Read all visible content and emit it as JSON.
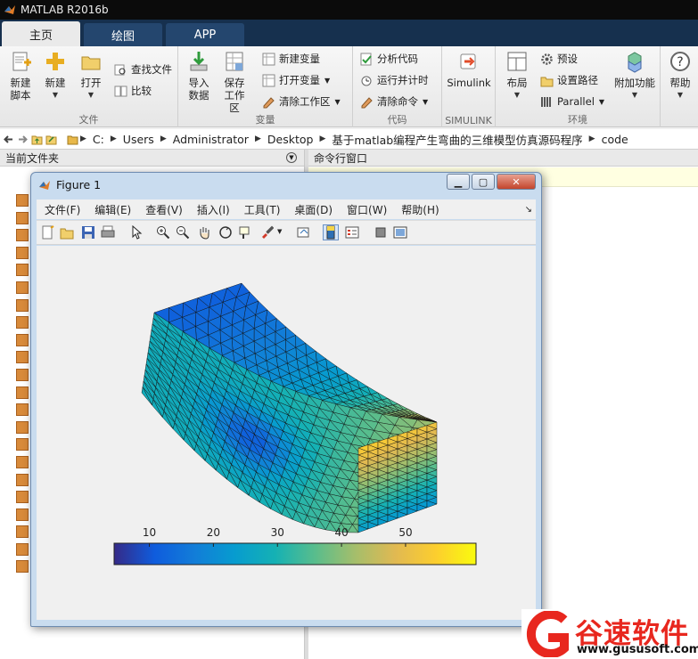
{
  "window": {
    "title": "MATLAB R2016b"
  },
  "tabs": [
    {
      "label": "主页",
      "active": true
    },
    {
      "label": "绘图",
      "active": false
    },
    {
      "label": "APP",
      "active": false
    }
  ],
  "ribbon": {
    "file": {
      "label": "文件",
      "new_script": "新建\n脚本",
      "new": "新建",
      "open": "打开",
      "find_files": "查找文件",
      "compare": "比较"
    },
    "variable": {
      "label": "变量",
      "import": "导入\n数据",
      "save_ws": "保存\n工作区",
      "new_var": "新建变量",
      "open_var": "打开变量",
      "clear_ws": "清除工作区"
    },
    "code": {
      "label": "代码",
      "analyze": "分析代码",
      "run_time": "运行并计时",
      "clear_cmd": "清除命令"
    },
    "simulink": {
      "label": "SIMULINK",
      "simulink": "Simulink"
    },
    "env": {
      "label": "环境",
      "layout": "布局",
      "prefs": "预设",
      "set_path": "设置路径",
      "parallel": "Parallel",
      "addons": "附加功能"
    },
    "resources": {
      "help": "帮助"
    }
  },
  "address": {
    "crumbs": [
      "C:",
      "Users",
      "Administrator",
      "Desktop",
      "基于matlab编程产生弯曲的三维模型仿真源码程序",
      "code"
    ]
  },
  "panels": {
    "current_folder": "当前文件夹",
    "command_window": "命令行窗口"
  },
  "figure": {
    "title": "Figure 1",
    "menu": [
      "文件(F)",
      "编辑(E)",
      "查看(V)",
      "插入(I)",
      "工具(T)",
      "桌面(D)",
      "窗口(W)",
      "帮助(H)"
    ]
  },
  "chart_data": {
    "type": "surface",
    "colorbar": {
      "ticks": [
        10,
        20,
        30,
        40,
        50
      ],
      "colormap": "parula"
    }
  },
  "watermark": {
    "brand": "谷速软件",
    "url": "www.gususoft.com",
    "color": "#e8271e"
  },
  "colors": {
    "tabbar": "#16304e",
    "titlebar": "#0b0b0b",
    "accent": "#0072bd"
  }
}
